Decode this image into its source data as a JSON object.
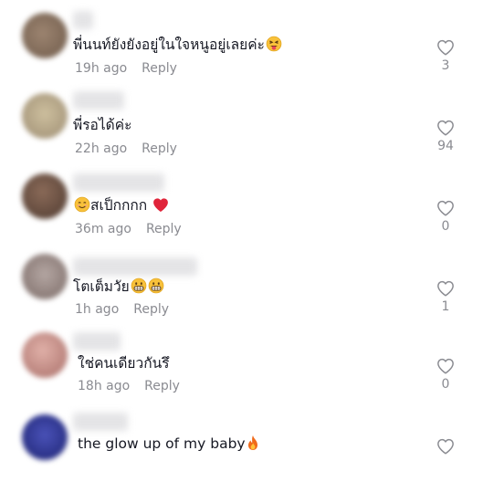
{
  "comments": [
    {
      "text": "พี่นนท์ยังยังอยู่ในใจหนูอยู่เลยค่ะ",
      "emojis": [
        "squint-tongue-emoji"
      ],
      "time": "19h ago",
      "reply_label": "Reply",
      "likes": "3",
      "avatar_color": "#8a7562"
    },
    {
      "text": "พี่รอได้ค่ะ",
      "emojis": [],
      "time": "22h ago",
      "reply_label": "Reply",
      "likes": "94",
      "avatar_color": "#b5a48a"
    },
    {
      "text": "สเป็กกกก",
      "emojis": [
        "smiling-face-emoji",
        "red-heart-emoji"
      ],
      "time": "36m ago",
      "reply_label": "Reply",
      "likes": "0",
      "avatar_color": "#6e5446"
    },
    {
      "text": "โตเต็มวัย",
      "emojis": [
        "grinning-face-emoji",
        "grinning-face-emoji"
      ],
      "time": "1h ago",
      "reply_label": "Reply",
      "likes": "1",
      "avatar_color": "#9a8a86"
    },
    {
      "text": "ใช่คนเดียวกันรึ",
      "emojis": [],
      "time": "18h ago",
      "reply_label": "Reply",
      "likes": "0",
      "avatar_color": "#c08a86"
    },
    {
      "text": "the glow up of my baby",
      "emojis": [
        "fire-emoji"
      ],
      "time": "",
      "reply_label": "",
      "likes": "",
      "avatar_color": "#2a2f8a"
    }
  ],
  "colors": {
    "text": "#161823",
    "meta": "#8a8b91",
    "icon": "#8a8b91",
    "background": "#ffffff"
  }
}
